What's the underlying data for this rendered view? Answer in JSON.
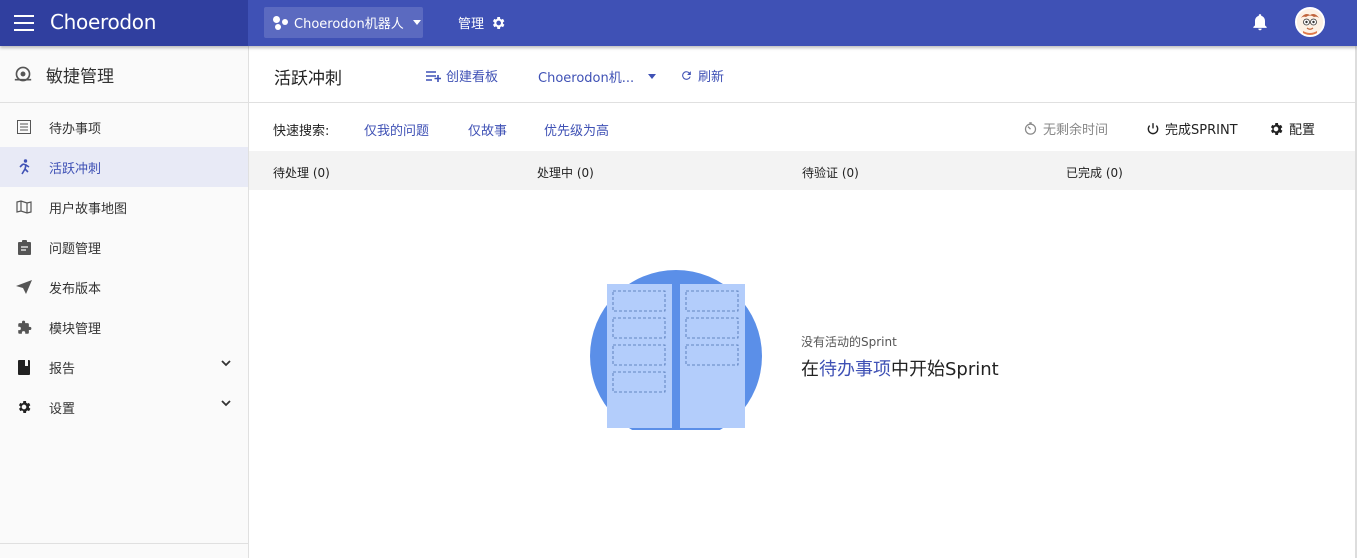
{
  "app": {
    "brand": "Choerodon"
  },
  "topbar": {
    "project_selector": "Choerodon机器人",
    "manage_label": "管理"
  },
  "sidebar": {
    "section_title": "敏捷管理",
    "items": [
      {
        "label": "待办事项",
        "icon": "list-icon"
      },
      {
        "label": "活跃冲刺",
        "icon": "run-icon",
        "active": true
      },
      {
        "label": "用户故事地图",
        "icon": "map-icon"
      },
      {
        "label": "问题管理",
        "icon": "clipboard-icon"
      },
      {
        "label": "发布版本",
        "icon": "send-icon"
      },
      {
        "label": "模块管理",
        "icon": "puzzle-icon"
      },
      {
        "label": "报告",
        "icon": "book-icon",
        "expandable": true
      },
      {
        "label": "设置",
        "icon": "gear-icon",
        "expandable": true
      }
    ]
  },
  "header": {
    "title": "活跃冲刺",
    "create_board": "创建看板",
    "board_selector": "Choerodon机...",
    "refresh": "刷新"
  },
  "quick_search": {
    "label": "快速搜索:",
    "filters": [
      "仅我的问题",
      "仅故事",
      "优先级为高"
    ],
    "no_time_left": "无剩余时间",
    "complete_sprint": "完成SPRINT",
    "config": "配置"
  },
  "columns": [
    "待处理 (0)",
    "处理中 (0)",
    "待验证 (0)",
    "已完成 (0)"
  ],
  "empty_state": {
    "subtitle": "没有活动的Sprint",
    "prefix": "在",
    "link": "待办事项",
    "suffix": "中开始Sprint"
  },
  "colors": {
    "primary": "#3f51b5",
    "primary_dark": "#303f9f",
    "art_blue": "#5b8fe8",
    "art_light": "#b3cdfb"
  }
}
